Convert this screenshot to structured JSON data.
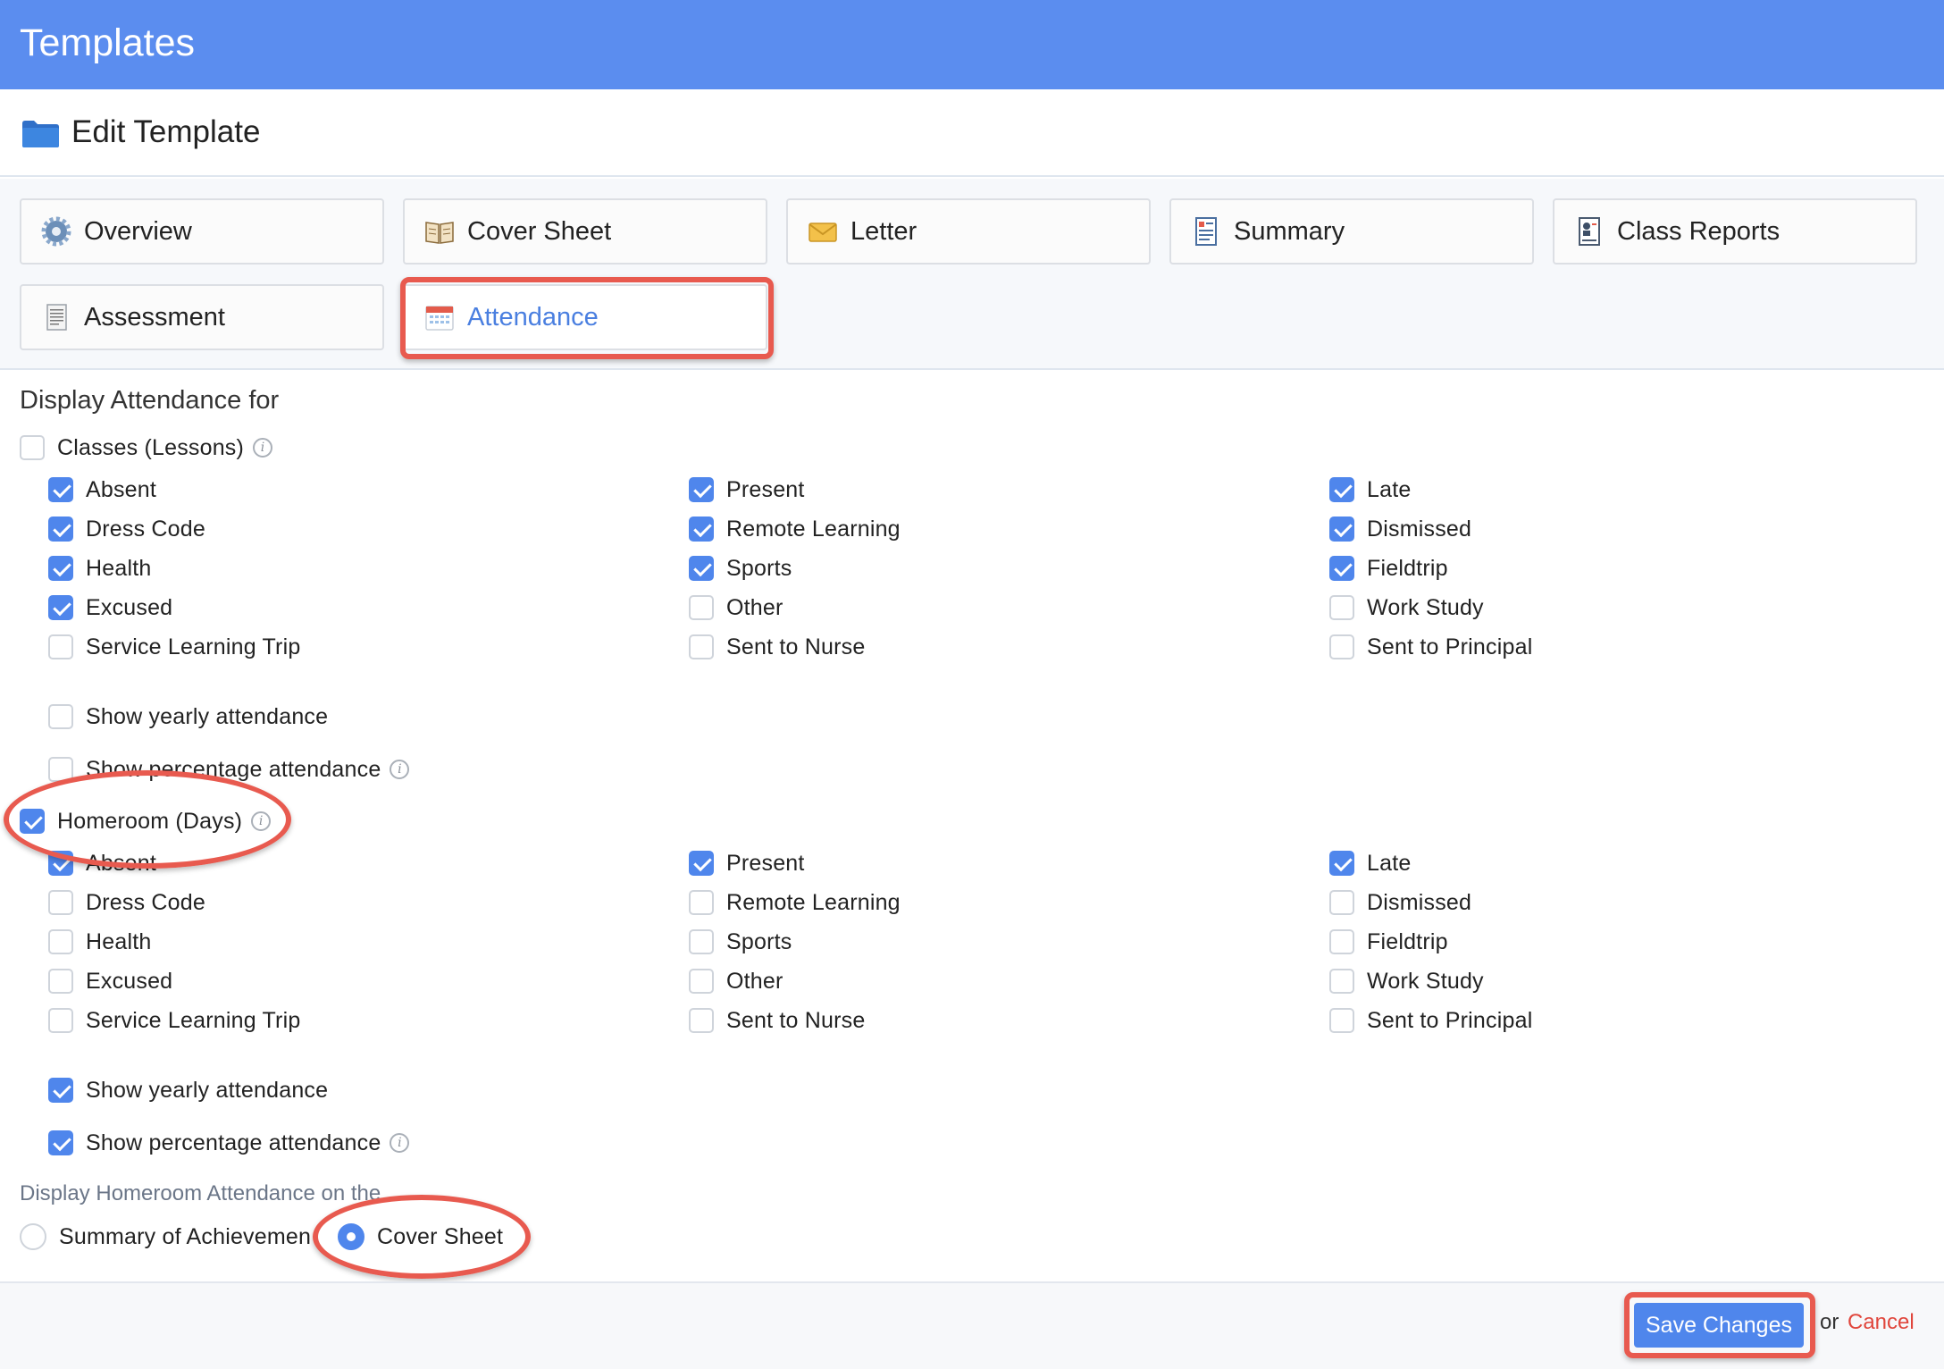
{
  "header": {
    "title": "Templates"
  },
  "edit": {
    "title": "Edit Template"
  },
  "tabs": [
    {
      "label": "Overview",
      "icon": "gear-icon"
    },
    {
      "label": "Cover Sheet",
      "icon": "book-icon"
    },
    {
      "label": "Letter",
      "icon": "envelope-icon"
    },
    {
      "label": "Summary",
      "icon": "summary-report-icon"
    },
    {
      "label": "Class Reports",
      "icon": "class-report-icon"
    },
    {
      "label": "Assessment",
      "icon": "document-icon"
    },
    {
      "label": "Attendance",
      "icon": "calendar-icon"
    }
  ],
  "active_tab": "Attendance",
  "display_heading": "Display Attendance for",
  "classes": {
    "label": "Classes (Lessons)",
    "checked": false,
    "options": [
      {
        "label": "Absent",
        "checked": true
      },
      {
        "label": "Present",
        "checked": true
      },
      {
        "label": "Late",
        "checked": true
      },
      {
        "label": "Dress Code",
        "checked": true
      },
      {
        "label": "Remote Learning",
        "checked": true
      },
      {
        "label": "Dismissed",
        "checked": true
      },
      {
        "label": "Health",
        "checked": true
      },
      {
        "label": "Sports",
        "checked": true
      },
      {
        "label": "Fieldtrip",
        "checked": true
      },
      {
        "label": "Excused",
        "checked": true
      },
      {
        "label": "Other",
        "checked": false
      },
      {
        "label": "Work Study",
        "checked": false
      },
      {
        "label": "Service Learning Trip",
        "checked": false
      },
      {
        "label": "Sent to Nurse",
        "checked": false
      },
      {
        "label": "Sent to Principal",
        "checked": false
      }
    ],
    "show_yearly": {
      "label": "Show yearly attendance",
      "checked": false
    },
    "show_percentage": {
      "label": "Show percentage attendance",
      "checked": false
    }
  },
  "homeroom": {
    "label": "Homeroom (Days)",
    "checked": true,
    "options": [
      {
        "label": "Absent",
        "checked": true
      },
      {
        "label": "Present",
        "checked": true
      },
      {
        "label": "Late",
        "checked": true
      },
      {
        "label": "Dress Code",
        "checked": false
      },
      {
        "label": "Remote Learning",
        "checked": false
      },
      {
        "label": "Dismissed",
        "checked": false
      },
      {
        "label": "Health",
        "checked": false
      },
      {
        "label": "Sports",
        "checked": false
      },
      {
        "label": "Fieldtrip",
        "checked": false
      },
      {
        "label": "Excused",
        "checked": false
      },
      {
        "label": "Other",
        "checked": false
      },
      {
        "label": "Work Study",
        "checked": false
      },
      {
        "label": "Service Learning Trip",
        "checked": false
      },
      {
        "label": "Sent to Nurse",
        "checked": false
      },
      {
        "label": "Sent to Principal",
        "checked": false
      }
    ],
    "show_yearly": {
      "label": "Show yearly attendance",
      "checked": true
    },
    "show_percentage": {
      "label": "Show percentage attendance",
      "checked": true
    }
  },
  "display_on": {
    "label": "Display Homeroom Attendance on the",
    "options": [
      {
        "label": "Summary of Achievemen",
        "checked": false
      },
      {
        "label": "Cover Sheet",
        "checked": true
      }
    ]
  },
  "footer": {
    "save_label": "Save Changes",
    "or_text": "or",
    "cancel_label": "Cancel"
  },
  "colors": {
    "header_bg": "#5b8def",
    "accent": "#4f86ec",
    "annotation": "#e85a4f",
    "cancel": "#e0463c"
  }
}
